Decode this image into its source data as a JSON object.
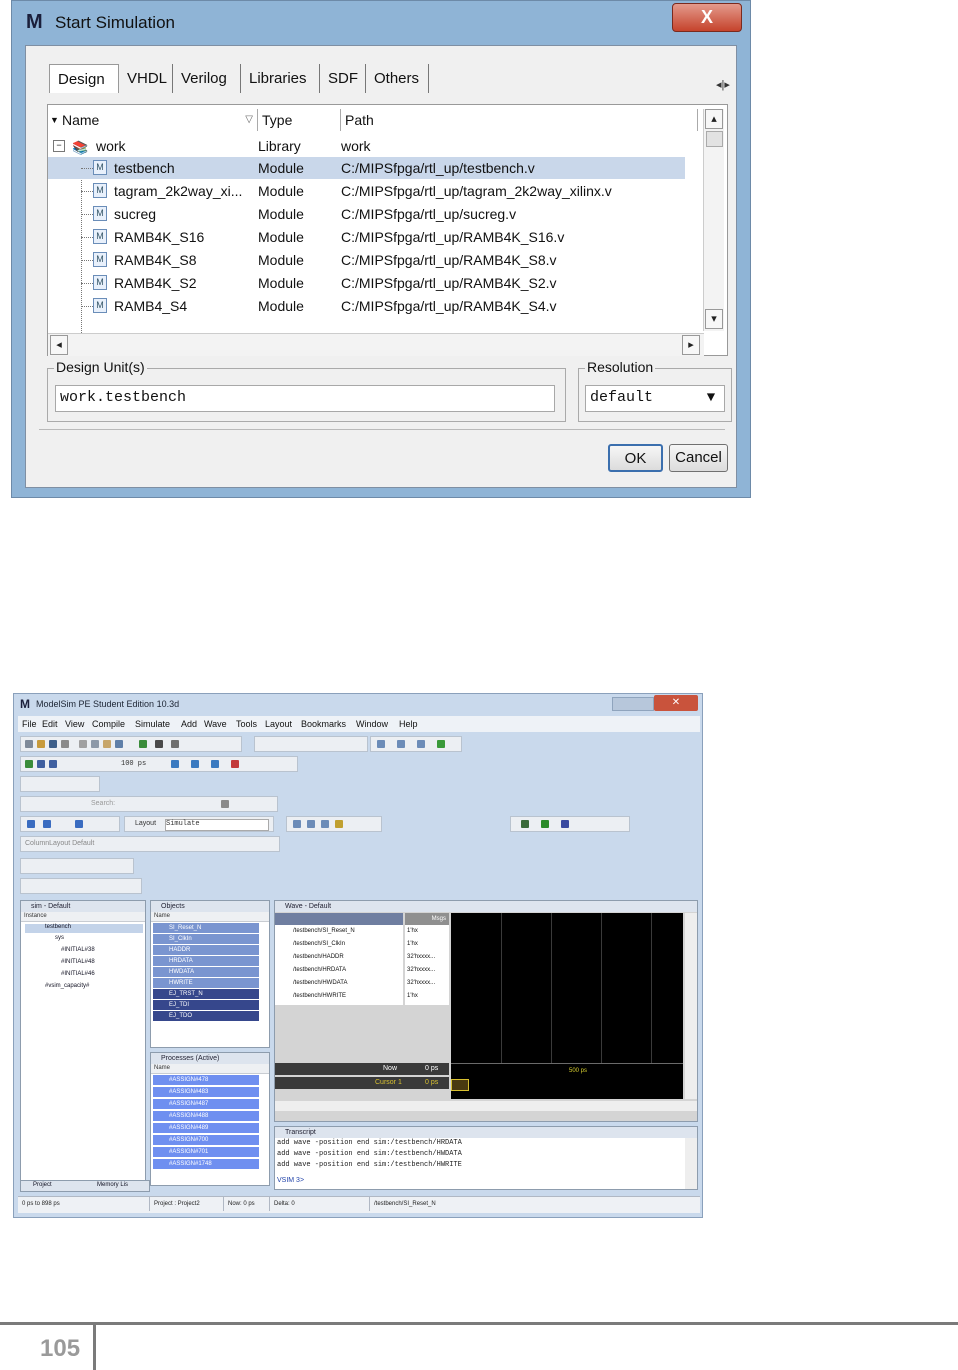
{
  "dialog": {
    "title": "Start Simulation",
    "close_label": "X",
    "tabs": [
      "Design",
      "VHDL",
      "Verilog",
      "Libraries",
      "SDF",
      "Others"
    ],
    "columns": [
      "Name",
      "Type",
      "Path"
    ],
    "rows": [
      {
        "name": "work",
        "type": "Library",
        "path": "work"
      },
      {
        "name": "testbench",
        "type": "Module",
        "path": "C:/MIPSfpga/rtl_up/testbench.v"
      },
      {
        "name": "tagram_2k2way_xi...",
        "type": "Module",
        "path": "C:/MIPSfpga/rtl_up/tagram_2k2way_xilinx.v"
      },
      {
        "name": "sucreg",
        "type": "Module",
        "path": "C:/MIPSfpga/rtl_up/sucreg.v"
      },
      {
        "name": "RAMB4K_S16",
        "type": "Module",
        "path": "C:/MIPSfpga/rtl_up/RAMB4K_S16.v"
      },
      {
        "name": "RAMB4K_S8",
        "type": "Module",
        "path": "C:/MIPSfpga/rtl_up/RAMB4K_S8.v"
      },
      {
        "name": "RAMB4K_S2",
        "type": "Module",
        "path": "C:/MIPSfpga/rtl_up/RAMB4K_S2.v"
      },
      {
        "name": "RAMB4_S4",
        "type": "Module",
        "path": "C:/MIPSfpga/rtl_up/RAMB4K_S4.v"
      }
    ],
    "design_units_label": "Design Unit(s)",
    "design_units_value": "work.testbench",
    "resolution_label": "Resolution",
    "resolution_value": "default",
    "ok_label": "OK",
    "cancel_label": "Cancel"
  },
  "modelsim": {
    "title": "ModelSim PE Student Edition 10.3d",
    "menu": [
      "File",
      "Edit",
      "View",
      "Compile",
      "Simulate",
      "Add",
      "Wave",
      "Tools",
      "Layout",
      "Bookmarks",
      "Window",
      "Help"
    ],
    "toolbar_runtime": "100 ps",
    "search_placeholder": "Search:",
    "layout_label": "Layout",
    "layout_value": "Simulate",
    "column_layout_value": "ColumnLayout Default",
    "sim_pane": {
      "title": "sim - Default",
      "header": "Instance",
      "items": [
        "testbench",
        "sys",
        "#INITIAL#38",
        "#INITIAL#48",
        "#INITIAL#46",
        "#vsim_capacity#"
      ]
    },
    "objects_pane": {
      "title": "Objects",
      "header": "Name",
      "items": [
        "SI_Reset_N",
        "SI_ClkIn",
        "HADDR",
        "HRDATA",
        "HWDATA",
        "HWRITE",
        "EJ_TRST_N",
        "EJ_TDI",
        "EJ_TDO"
      ]
    },
    "processes_pane": {
      "title": "Processes (Active)",
      "header": "Name",
      "items": [
        "#ASSIGN#478",
        "#ASSIGN#483",
        "#ASSIGN#487",
        "#ASSIGN#488",
        "#ASSIGN#489",
        "#ASSIGN#700",
        "#ASSIGN#701",
        "#ASSIGN#1748"
      ]
    },
    "wave_pane": {
      "title": "Wave - Default",
      "msgs_header": "Msgs",
      "signals": [
        {
          "name": "/testbench/SI_Reset_N",
          "value": "1'hx"
        },
        {
          "name": "/testbench/SI_ClkIn",
          "value": "1'hx"
        },
        {
          "name": "/testbench/HADDR",
          "value": "32'hxxxx..."
        },
        {
          "name": "/testbench/HRDATA",
          "value": "32'hxxxx..."
        },
        {
          "name": "/testbench/HWDATA",
          "value": "32'hxxxx..."
        },
        {
          "name": "/testbench/HWRITE",
          "value": "1'hx"
        }
      ],
      "now_label": "Now",
      "now_value": "0 ps",
      "cursor_label": "Cursor 1",
      "cursor_value": "0 ps",
      "time_marker": "500 ps"
    },
    "transcript": {
      "title": "Transcript",
      "lines": [
        "add wave -position end  sim:/testbench/HRDATA",
        "add wave -position end  sim:/testbench/HWDATA",
        "add wave -position end  sim:/testbench/HWRITE"
      ],
      "prompt": "VSIM 3>"
    },
    "bottom_tabs": [
      "Project",
      "Memory Lis"
    ],
    "status": [
      "0 ps to 898 ps",
      "Project : Project2",
      "Now: 0 ps",
      "Delta: 0",
      "/testbench/SI_Reset_N"
    ]
  },
  "page_number": "105",
  "colors": {
    "dialog_frame": "#8fb4d6",
    "wave_background": "#000000",
    "selection": "#6f8ff0",
    "close_button": "#c5432c"
  }
}
